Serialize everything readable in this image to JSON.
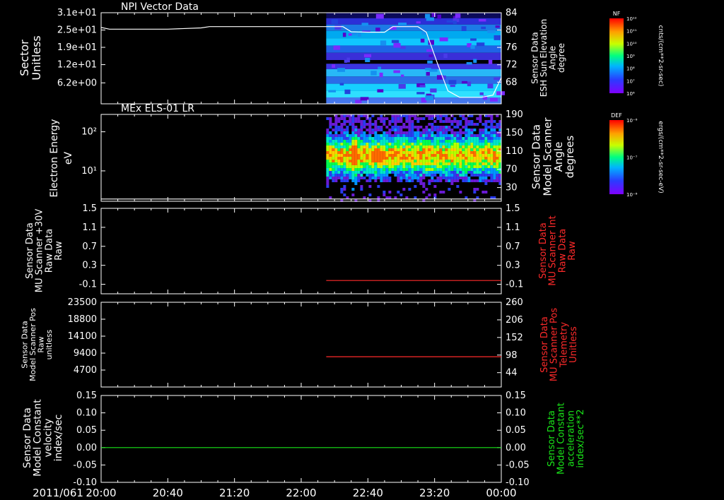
{
  "figure": {
    "date_label": "2011/061",
    "x_ticks": [
      "20:00",
      "20:40",
      "21:20",
      "22:00",
      "22:40",
      "23:20",
      "00:00"
    ]
  },
  "colorbars": [
    {
      "label": "NF",
      "unit": "cnts/(cm**2-sr-sec)",
      "ticks": [
        "10¹²",
        "10¹¹",
        "10¹⁰",
        "10⁹",
        "10⁸",
        "10⁷",
        "10⁶"
      ]
    },
    {
      "label": "DEF",
      "unit": "ergs/(cm**2-sr-sec-eV)",
      "ticks": [
        "10⁻⁶",
        "10⁻⁷",
        "10⁻⁸"
      ]
    }
  ],
  "chart_data": [
    {
      "type": "heatmap",
      "title": "NPI Vector Data",
      "ylabel": "Sector Unitless",
      "y_ticks": [
        "3.1e+01",
        "2.5e+01",
        "1.9e+01",
        "1.2e+01",
        "6.2e+00"
      ],
      "y2label": [
        "Sensor Data",
        "ESH Sun Elevation",
        "Angle",
        "degree"
      ],
      "y2_ticks": [
        84,
        80,
        76,
        72,
        68
      ],
      "y2lim": [
        63,
        84
      ],
      "color": "#ffffff",
      "data_start": "22:15",
      "line": {
        "name": "ESH Sun Elevation Angle",
        "points": [
          [
            "20:00",
            80.6
          ],
          [
            "20:05",
            80.2
          ],
          [
            "20:40",
            80.2
          ],
          [
            "21:00",
            80.5
          ],
          [
            "21:05",
            80.8
          ],
          [
            "22:15",
            80.8
          ],
          [
            "22:25",
            80.8
          ],
          [
            "22:30",
            79.6
          ],
          [
            "22:40",
            79.5
          ],
          [
            "22:50",
            79.5
          ],
          [
            "22:55",
            80.8
          ],
          [
            "23:10",
            80.8
          ],
          [
            "23:15",
            79.5
          ],
          [
            "23:22",
            72
          ],
          [
            "23:28",
            66
          ],
          [
            "23:35",
            64.5
          ],
          [
            "23:48",
            64.5
          ],
          [
            "23:55",
            65
          ],
          [
            "00:00",
            69
          ]
        ]
      }
    },
    {
      "type": "heatmap",
      "title": "MEx ELS-01 LR",
      "ylabel": "Electron Energy eV",
      "y_ticks": [
        "10²",
        "10¹"
      ],
      "y2label": [
        "Sensor Data",
        "Model Scanner",
        "Angle",
        "degrees"
      ],
      "y2_ticks": [
        190,
        150,
        110,
        70,
        30
      ],
      "y2lim": [
        0,
        190
      ],
      "color": "#ffffff",
      "data_start": "22:15",
      "line": {
        "name": "Model Scanner Angle",
        "points": [
          [
            "20:00",
            5
          ],
          [
            "00:00",
            5
          ]
        ]
      }
    },
    {
      "type": "line",
      "ylabel": [
        "Sensor Data",
        "MU Scanner +30V",
        "Raw Data",
        "Raw"
      ],
      "y_ticks": [
        1.5,
        1.1,
        0.7,
        0.3,
        -0.1
      ],
      "ylim": [
        -0.3,
        1.5
      ],
      "y2label": [
        "Sensor Data",
        "MU Scanner Int",
        "Raw Data",
        "Raw"
      ],
      "y2_ticks": [
        1.5,
        1.1,
        0.7,
        0.3,
        -0.1
      ],
      "y2_color": "#ff2a2a",
      "series": [
        {
          "color": "#ff2a2a",
          "points": [
            [
              "22:15",
              -0.02
            ],
            [
              "00:00",
              -0.02
            ]
          ]
        }
      ]
    },
    {
      "type": "line",
      "ylabel": [
        "Sensor Data",
        "Model Scanner Pos",
        "Raw",
        "unitless"
      ],
      "y_ticks": [
        23500,
        18800,
        14100,
        9400,
        4700
      ],
      "ylim": [
        0,
        23500
      ],
      "y2label": [
        "Sensor Data",
        "MU Scanner Pos",
        "Telemetry",
        "Unitless"
      ],
      "y2_ticks": [
        260,
        206,
        152,
        98,
        44
      ],
      "y2lim": [
        0,
        260
      ],
      "y2_color": "#ff2a2a",
      "series": [
        {
          "color": "#ff2a2a",
          "points": [
            [
              "22:15",
              8400
            ],
            [
              "00:00",
              8400
            ]
          ]
        }
      ]
    },
    {
      "type": "line",
      "ylabel": [
        "Sensor Data",
        "Model Constant",
        "velocity",
        "index/sec"
      ],
      "y_ticks": [
        "0.15",
        "0.10",
        "0.05",
        "0.00",
        "-0.05",
        "-0.10"
      ],
      "ylim": [
        -0.1,
        0.15
      ],
      "y2label": [
        "Sensor Data",
        "Model Constant",
        "acceleration",
        "index/sec**2"
      ],
      "y2_ticks": [
        "0.15",
        "0.10",
        "0.05",
        "0.00",
        "-0.05",
        "-0.10"
      ],
      "y2_color": "#19e619",
      "series": [
        {
          "color": "#19e619",
          "points": [
            [
              "20:00",
              0
            ],
            [
              "00:00",
              0
            ]
          ]
        }
      ]
    }
  ]
}
